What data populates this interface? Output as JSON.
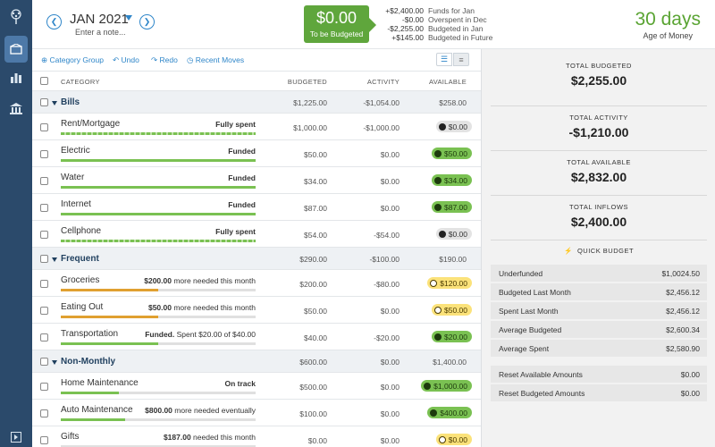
{
  "rail": {
    "icons": [
      "tree-logo-icon",
      "budget-icon",
      "reports-icon",
      "accounts-icon",
      "collapse-icon"
    ]
  },
  "header": {
    "month": "JAN 2021",
    "note": "Enter a note...",
    "tbb_amount": "$0.00",
    "tbb_label": "To be Budgeted",
    "summary": [
      {
        "value": "+$2,400.00",
        "label": "Funds for Jan"
      },
      {
        "value": "-$0.00",
        "label": "Overspent in Dec"
      },
      {
        "value": "-$2,255.00",
        "label": "Budgeted in Jan"
      },
      {
        "value": "+$145.00",
        "label": "Budgeted in Future"
      }
    ],
    "age_value": "30 days",
    "age_label": "Age of Money"
  },
  "toolbar": {
    "category_group": "Category Group",
    "undo": "Undo",
    "redo": "Redo",
    "recent_moves": "Recent Moves"
  },
  "columns": {
    "category": "CATEGORY",
    "budgeted": "BUDGETED",
    "activity": "ACTIVITY",
    "available": "AVAILABLE"
  },
  "groups": [
    {
      "name": "Bills",
      "budgeted": "$1,225.00",
      "activity": "-$1,054.00",
      "available": "$258.00"
    },
    {
      "name": "Frequent",
      "budgeted": "$290.00",
      "activity": "-$100.00",
      "available": "$190.00"
    },
    {
      "name": "Non-Monthly",
      "budgeted": "$600.00",
      "activity": "$0.00",
      "available": "$1,400.00"
    }
  ],
  "items": [
    {
      "name": "Rent/Mortgage",
      "status_bold": "Fully spent",
      "status_rest": "",
      "budgeted": "$1,000.00",
      "activity": "-$1,000.00",
      "available": "$0.00",
      "pill": "gray",
      "progress": 1.0
    },
    {
      "name": "Electric",
      "status_bold": "Funded",
      "status_rest": "",
      "budgeted": "$50.00",
      "activity": "$0.00",
      "available": "$50.00",
      "pill": "green",
      "progress": 1.0
    },
    {
      "name": "Water",
      "status_bold": "Funded",
      "status_rest": "",
      "budgeted": "$34.00",
      "activity": "$0.00",
      "available": "$34.00",
      "pill": "green",
      "progress": 1.0
    },
    {
      "name": "Internet",
      "status_bold": "Funded",
      "status_rest": "",
      "budgeted": "$87.00",
      "activity": "$0.00",
      "available": "$87.00",
      "pill": "green",
      "progress": 1.0
    },
    {
      "name": "Cellphone",
      "status_bold": "Fully spent",
      "status_rest": "",
      "budgeted": "$54.00",
      "activity": "-$54.00",
      "available": "$0.00",
      "pill": "gray",
      "progress": 1.0
    },
    {
      "name": "Groceries",
      "status_bold": "$200.00",
      "status_rest": " more needed this month",
      "budgeted": "$200.00",
      "activity": "-$80.00",
      "available": "$120.00",
      "pill": "yellow",
      "progress": 0.5
    },
    {
      "name": "Eating Out",
      "status_bold": "$50.00",
      "status_rest": " more needed this month",
      "budgeted": "$50.00",
      "activity": "$0.00",
      "available": "$50.00",
      "pill": "yellow",
      "progress": 0.5
    },
    {
      "name": "Transportation",
      "status_bold": "Funded.",
      "status_rest": " Spent $20.00 of $40.00",
      "budgeted": "$40.00",
      "activity": "-$20.00",
      "available": "$20.00",
      "pill": "green",
      "progress": 0.5
    },
    {
      "name": "Home Maintenance",
      "status_bold": "On track",
      "status_rest": "",
      "budgeted": "$500.00",
      "activity": "$0.00",
      "available": "$1,000.00",
      "pill": "green",
      "progress": 0.3
    },
    {
      "name": "Auto Maintenance",
      "status_bold": "$800.00",
      "status_rest": " more needed eventually",
      "budgeted": "$100.00",
      "activity": "$0.00",
      "available": "$400.00",
      "pill": "green",
      "progress": 0.33
    },
    {
      "name": "Gifts",
      "status_bold": "$187.00",
      "status_rest": " needed this month",
      "budgeted": "$0.00",
      "activity": "$0.00",
      "available": "$0.00",
      "pill": "yellow",
      "progress": 0.0
    }
  ],
  "inspector": {
    "stats": [
      {
        "label": "TOTAL BUDGETED",
        "value": "$2,255.00"
      },
      {
        "label": "TOTAL ACTIVITY",
        "value": "-$1,210.00"
      },
      {
        "label": "TOTAL AVAILABLE",
        "value": "$2,832.00"
      },
      {
        "label": "TOTAL INFLOWS",
        "value": "$2,400.00"
      }
    ],
    "quick_budget_title": "QUICK BUDGET",
    "quick": [
      {
        "label": "Underfunded",
        "amount": "$1,0024.50"
      },
      {
        "label": "Budgeted Last Month",
        "amount": "$2,456.12"
      },
      {
        "label": "Spent Last Month",
        "amount": "$2,456.12"
      },
      {
        "label": "Average Budgeted",
        "amount": "$2,600.34"
      },
      {
        "label": "Average Spent",
        "amount": "$2,580.90"
      }
    ],
    "reset": [
      {
        "label": "Reset Available Amounts",
        "amount": "$0.00"
      },
      {
        "label": "Reset Budgeted Amounts",
        "amount": "$0.00"
      }
    ]
  },
  "colors": {
    "rail": "#2b4a6b",
    "accent": "#2f86c9",
    "green": "#5fa63c",
    "pill_green": "#7ac152",
    "pill_yellow": "#fbe27a",
    "bar_orange": "#e0a030"
  }
}
